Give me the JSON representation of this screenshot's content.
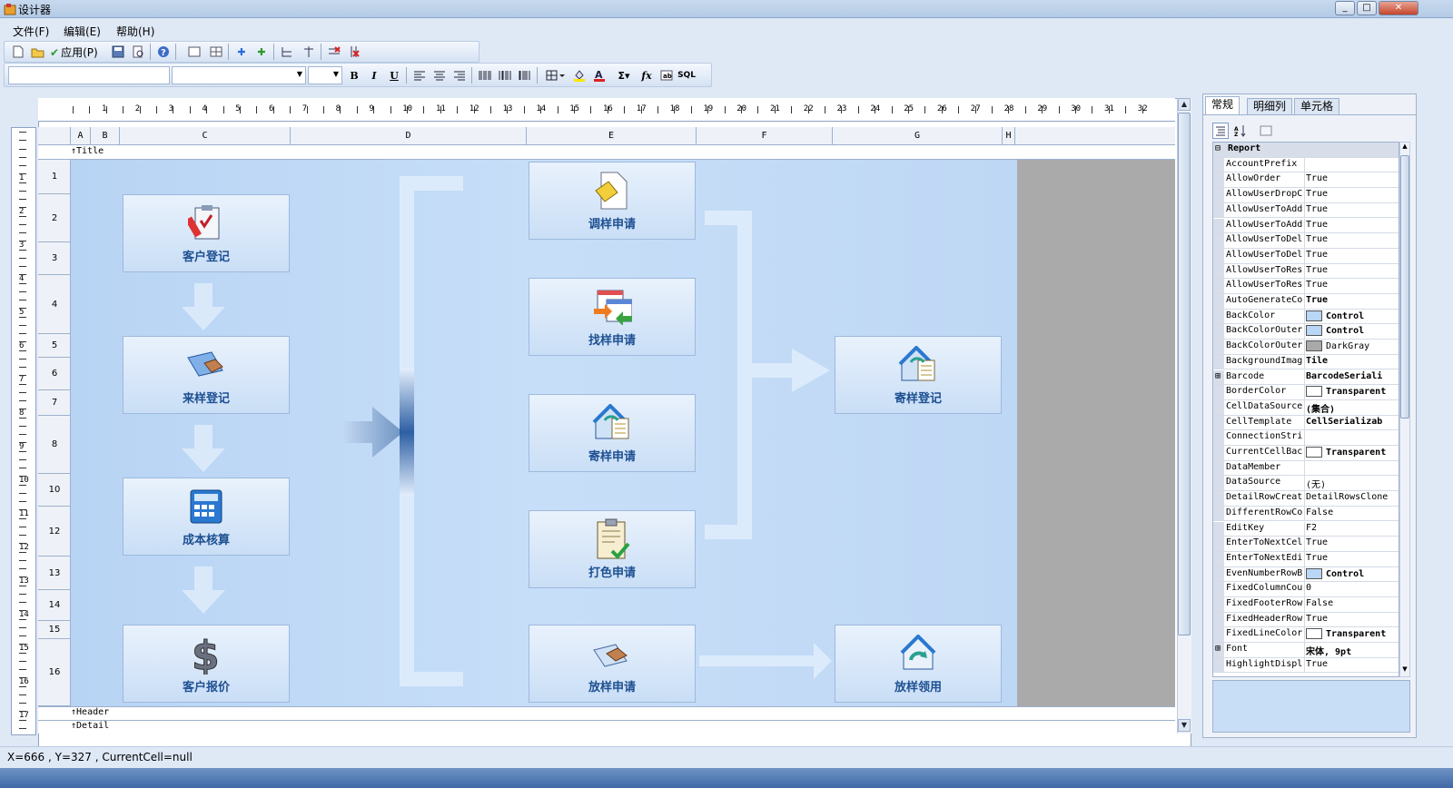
{
  "window": {
    "title": "设计器"
  },
  "menu": [
    "文件(F)",
    "编辑(E)",
    "帮助(H)"
  ],
  "toolbar": {
    "apply_label": "应用(P)",
    "bold": "B",
    "italic": "I",
    "underline": "U"
  },
  "ruler": {
    "h_numbers": [
      "1",
      "2",
      "3",
      "4",
      "5",
      "6",
      "7",
      "8",
      "9",
      "10",
      "11",
      "12",
      "13",
      "14",
      "15",
      "16",
      "17",
      "18",
      "19",
      "20",
      "21",
      "22",
      "23",
      "24",
      "25",
      "26",
      "27",
      "28",
      "29",
      "30",
      "31",
      "32"
    ],
    "v_numbers": [
      "1",
      "2",
      "3",
      "4",
      "5",
      "6",
      "7",
      "8",
      "9",
      "10",
      "11",
      "12",
      "13",
      "14",
      "15",
      "16",
      "17"
    ]
  },
  "columns": [
    "A",
    "B",
    "C",
    "D",
    "E",
    "F",
    "G",
    "H"
  ],
  "rows": [
    "1",
    "2",
    "3",
    "4",
    "5",
    "6",
    "7",
    "8",
    "10",
    "12",
    "13",
    "14",
    "15",
    "16"
  ],
  "bands": {
    "title": "Title",
    "header": "Header",
    "detail": "Detail"
  },
  "flow": {
    "left": [
      "客户登记",
      "来样登记",
      "成本核算",
      "客户报价"
    ],
    "middle": [
      "调样申请",
      "找样申请",
      "寄样申请",
      "打色申请",
      "放样申请"
    ],
    "right": [
      "寄样登记",
      "放样领用"
    ]
  },
  "panel": {
    "tabs": [
      "常规",
      "明细列",
      "单元格"
    ],
    "category": "Report",
    "properties": [
      {
        "name": "AccountPrefix",
        "value": ""
      },
      {
        "name": "AllowOrder",
        "value": "True"
      },
      {
        "name": "AllowUserDropC",
        "value": "True"
      },
      {
        "name": "AllowUserToAdd",
        "value": "True"
      },
      {
        "name": "AllowUserToAdd",
        "value": "True"
      },
      {
        "name": "AllowUserToDel",
        "value": "True"
      },
      {
        "name": "AllowUserToDel",
        "value": "True"
      },
      {
        "name": "AllowUserToRes",
        "value": "True"
      },
      {
        "name": "AllowUserToRes",
        "value": "True"
      },
      {
        "name": "AutoGenerateCo",
        "value": "True",
        "bold": true
      },
      {
        "name": "BackColor",
        "value": "Control",
        "swatch": "#b9d6f6",
        "bold": true
      },
      {
        "name": "BackColorOuter",
        "value": "Control",
        "swatch": "#b9d6f6",
        "bold": true
      },
      {
        "name": "BackColorOuter",
        "value": "DarkGray",
        "swatch": "#a9a9a9"
      },
      {
        "name": "BackgroundImag",
        "value": "Tile",
        "bold": true
      },
      {
        "name": "Barcode",
        "value": "BarcodeSeriali",
        "bold": true,
        "expand": true
      },
      {
        "name": "BorderColor",
        "value": "Transparent",
        "swatch": "#ffffff",
        "bold": true
      },
      {
        "name": "CellDataSource",
        "value": "(集合)",
        "bold": true
      },
      {
        "name": "CellTemplate",
        "value": "CellSerializab",
        "bold": true
      },
      {
        "name": "ConnectionStri",
        "value": ""
      },
      {
        "name": "CurrentCellBac",
        "value": "Transparent",
        "swatch": "#ffffff",
        "bold": true
      },
      {
        "name": "DataMember",
        "value": ""
      },
      {
        "name": "DataSource",
        "value": "(无)"
      },
      {
        "name": "DetailRowCreat",
        "value": "DetailRowsClone"
      },
      {
        "name": "DifferentRowCo",
        "value": "False"
      },
      {
        "name": "EditKey",
        "value": "F2"
      },
      {
        "name": "EnterToNextCel",
        "value": "True"
      },
      {
        "name": "EnterToNextEdi",
        "value": "True"
      },
      {
        "name": "EvenNumberRowB",
        "value": "Control",
        "swatch": "#b9d6f6",
        "bold": true
      },
      {
        "name": "FixedColumnCou",
        "value": "0"
      },
      {
        "name": "FixedFooterRow",
        "value": "False"
      },
      {
        "name": "FixedHeaderRow",
        "value": "True"
      },
      {
        "name": "FixedLineColor",
        "value": "Transparent",
        "swatch": "#ffffff",
        "bold": true
      },
      {
        "name": "Font",
        "value": "宋体, 9pt",
        "bold": true,
        "expand": true
      },
      {
        "name": "HighlightDispl",
        "value": "True"
      }
    ]
  },
  "status": "X=666 , Y=327 , CurrentCell=null"
}
